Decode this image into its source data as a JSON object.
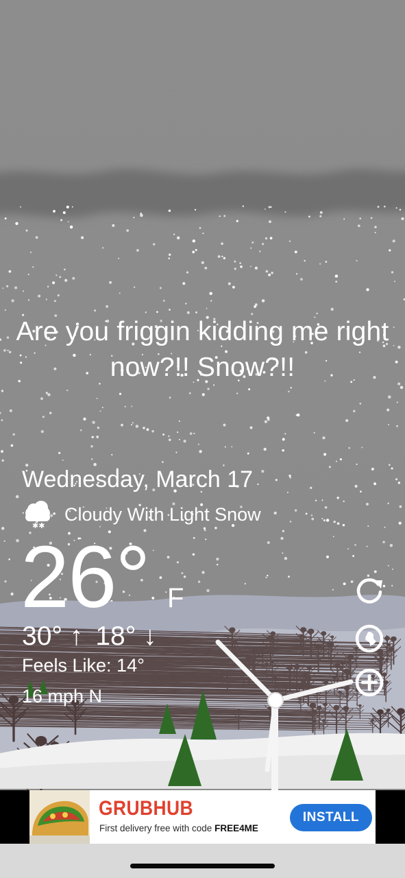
{
  "headline": "Are you friggin kidding me right now?!! Snow?!!",
  "date": "Wednesday, March 17",
  "condition": {
    "icon": "cloud-snow-icon",
    "text": "Cloudy With Light Snow"
  },
  "temperature": {
    "current": "26°",
    "unit": "F",
    "high": "30° ↑",
    "low": "18° ↓",
    "feels_like": "Feels Like: 14°",
    "wind": "16 mph N"
  },
  "side_buttons": [
    {
      "name": "refresh-icon"
    },
    {
      "name": "globe-location-icon"
    },
    {
      "name": "add-location-icon"
    }
  ],
  "ad": {
    "brand": "GRUBHUB",
    "tagline": "First delivery free with code",
    "code": "FREE4ME",
    "cta": "INSTALL",
    "brand_color": "#e0412f",
    "cta_color": "#2374d8"
  },
  "colors": {
    "sky": "#8a8a8a",
    "cloud_band": "#6f6f6f",
    "snow_ground": "#f2f2f2",
    "hills": "#a4a7b6",
    "tree": "#2f6b27"
  }
}
